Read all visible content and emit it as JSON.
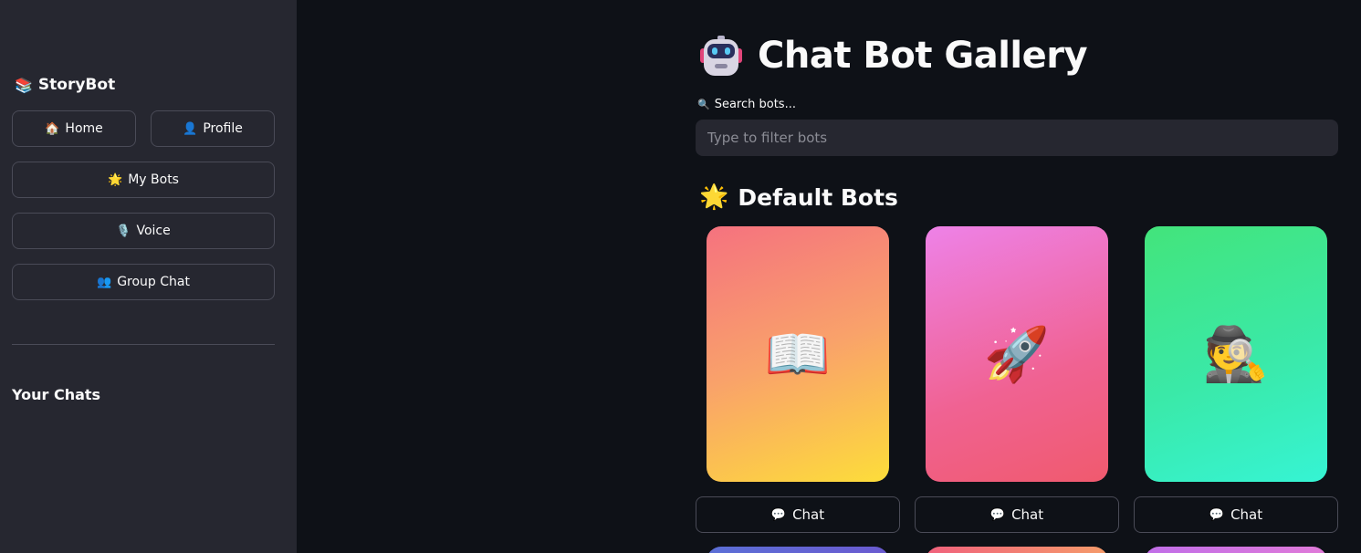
{
  "sidebar": {
    "brand": {
      "icon": "📚",
      "label": "StoryBot"
    },
    "buttons": [
      {
        "icon": "🏠",
        "label": "Home"
      },
      {
        "icon": "👤",
        "label": "Profile"
      },
      {
        "icon": "🌟",
        "label": "My Bots"
      },
      {
        "icon": "🎙️",
        "label": "Voice"
      },
      {
        "icon": "👥",
        "label": "Group Chat"
      }
    ],
    "your_chats": "Your Chats"
  },
  "main": {
    "title": "Chat Bot Gallery",
    "title_icon": "robot-icon",
    "search": {
      "label_icon": "🔍",
      "label": "Search bots...",
      "placeholder": "Type to filter bots",
      "value": ""
    },
    "section": {
      "icon": "🌟",
      "title": "Default Bots"
    },
    "cards": [
      {
        "emoji": "📖",
        "icon_name": "open-book-icon"
      },
      {
        "emoji": "🚀",
        "icon_name": "rocket-icon"
      },
      {
        "emoji": "🕵️",
        "icon_name": "detective-icon"
      }
    ],
    "chat_button": {
      "icon": "💬",
      "label": "Chat"
    }
  },
  "colors": {
    "background": "#0e1117",
    "sidebar": "#262730",
    "border": "#4a4b57",
    "text": "#fafafa",
    "placeholder": "#8b8c95"
  }
}
